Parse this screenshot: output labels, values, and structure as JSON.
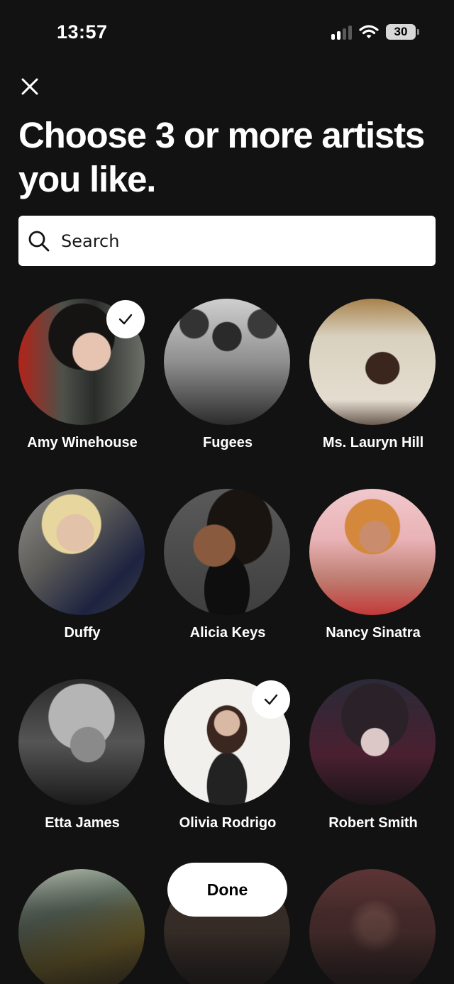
{
  "status_bar": {
    "time": "13:57",
    "battery": "30"
  },
  "header": {
    "close_icon": "close-icon",
    "title_line1": "Choose 3 or more artists",
    "title_line2": "you like."
  },
  "search": {
    "placeholder": "Search",
    "value": ""
  },
  "artists": [
    {
      "name": "Amy Winehouse",
      "selected": true
    },
    {
      "name": "Fugees",
      "selected": false
    },
    {
      "name": "Ms. Lauryn Hill",
      "selected": false
    },
    {
      "name": "Duffy",
      "selected": false
    },
    {
      "name": "Alicia Keys",
      "selected": false
    },
    {
      "name": "Nancy Sinatra",
      "selected": false
    },
    {
      "name": "Etta James",
      "selected": false
    },
    {
      "name": "Olivia Rodrigo",
      "selected": true
    },
    {
      "name": "Robert Smith",
      "selected": false
    }
  ],
  "footer": {
    "done_label": "Done"
  },
  "colors": {
    "background": "#121212",
    "text": "#ffffff",
    "button": "#ffffff"
  }
}
